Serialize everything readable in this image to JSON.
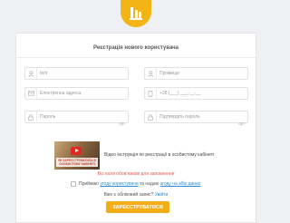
{
  "header": {
    "logo_icon": "factory-logo-icon"
  },
  "form": {
    "title": "Реєстрація нового користувача",
    "first_name": {
      "placeholder": "Ім'я",
      "icon": "user-icon"
    },
    "last_name": {
      "placeholder": "Прізвище",
      "icon": "user-icon"
    },
    "email": {
      "placeholder": "Електронна адреса",
      "icon": "envelope-icon"
    },
    "phone": {
      "placeholder": "+38 (___) ___-__-__",
      "icon": "phone-icon"
    },
    "password": {
      "placeholder": "Пароль",
      "icon": "lock-icon"
    },
    "password_confirm": {
      "placeholder": "Підтвердіть пароль",
      "icon": "lock-icon"
    },
    "video": {
      "thumbnail_text": "ЯК ЗАРЕЄСТРУВАТИСЬ В ОСОБИСТОМУ КАБІНЕТІ",
      "caption": "Відео інструкція по реєстрації в особистому кабінеті"
    },
    "required_note": "Всі поля обов'язкові для заповнення",
    "agreement": {
      "prefix": "Приймаю ",
      "link1": "угоду користувача",
      "middle": " та надаю ",
      "link2": "згоду на збір даних"
    },
    "account": {
      "question": "Вже є обліковий запис?",
      "login_link": "Увійти"
    },
    "submit_label": "ЗАРЕЄСТРУВАТИСЯ"
  },
  "colors": {
    "accent": "#f3ad16",
    "link": "#2a8cd4",
    "warning": "#e05a4a",
    "background": "#eef0f3"
  }
}
